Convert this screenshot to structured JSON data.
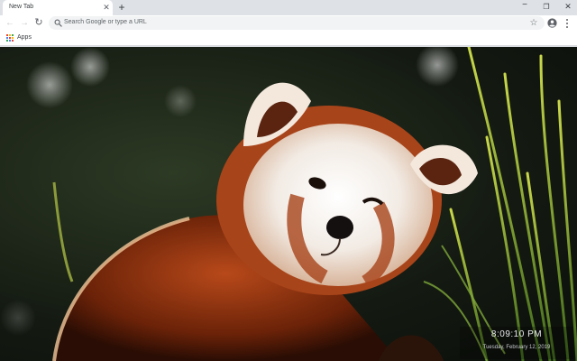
{
  "browser": {
    "tabs": [
      {
        "title": "New Tab",
        "close_glyph": "✕"
      }
    ],
    "new_tab_glyph": "+",
    "window_controls": {
      "minimize": "−",
      "restore": "❐",
      "close": "✕"
    },
    "toolbar": {
      "back_glyph": "←",
      "forward_glyph": "→",
      "reload_glyph": "↻",
      "omnibox_placeholder": "Search Google or type a URL",
      "bookmark_glyph": "☆"
    },
    "bookmarks_bar": {
      "apps_label": "Apps"
    }
  },
  "new_tab_page": {
    "wallpaper_subject": "red-panda",
    "clock": {
      "time": "8:09:10 PM",
      "date": "Tuesday, February 12, 2019"
    }
  },
  "colors": {
    "tabstrip_bg": "#dee1e6",
    "toolbar_bg": "#ffffff",
    "omnibox_bg": "#f1f3f4",
    "apps_dots": [
      "#ea4335",
      "#fbbc05",
      "#34a853",
      "#4285f4"
    ]
  }
}
